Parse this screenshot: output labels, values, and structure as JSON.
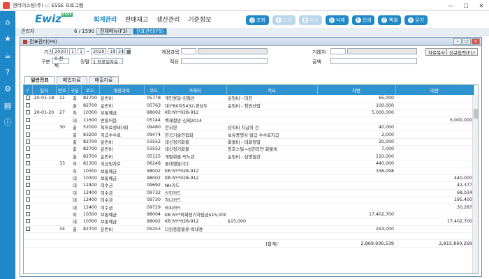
{
  "window": {
    "title": "엔터이스팅(주) ::: ESSE 프로그램",
    "controls": [
      "—",
      "☐",
      "✕"
    ]
  },
  "header": {
    "logo": {
      "text_e": "E",
      "text_wiz": "wiz",
      "badge": "ESSE"
    },
    "menus": [
      "회계관리",
      "판매재고",
      "생산관리",
      "기준정보"
    ],
    "toolbar": [
      {
        "label": "조회",
        "icon": "Q"
      },
      {
        "label": "입력",
        "icon": "I"
      },
      {
        "label": "저장",
        "icon": "S"
      },
      {
        "label": "삭제",
        "icon": "D"
      },
      {
        "label": "인쇄",
        "icon": "P"
      },
      {
        "label": "엑셀",
        "icon": "E"
      },
      {
        "label": "닫기",
        "icon": "X"
      }
    ]
  },
  "status": {
    "user": "관리자",
    "count": "6 / 1590",
    "tabs": [
      "전체메뉴(F3)",
      "전표관리(F9)"
    ]
  },
  "subwindow": {
    "title": "전표관리(F9)"
  },
  "filter": {
    "period_label": "기간",
    "from_y": "2020",
    "from_m": "1",
    "from_d": "1",
    "to_y": "2020",
    "to_m": "10",
    "to_d": "24",
    "account_label": "계정과목",
    "vendor_label": "거래처",
    "type_label": "구분",
    "type_value": "0.전체",
    "sort_label": "정렬",
    "sort_value": "1.전표일자순",
    "memo_label": "적요",
    "amount_label": "금액",
    "copy_btn": "자료복사",
    "new_btn": "신규입력(F1)"
  },
  "tabs": [
    "일반전표",
    "매입자료",
    "매출자료"
  ],
  "columns": [
    "√",
    "일자",
    "번호",
    "구분",
    "코드",
    "계정과목",
    "코드",
    "거래처",
    "적요",
    "차변",
    "대변"
  ],
  "rows": [
    [
      "20-01-18",
      "11",
      "출",
      "82700",
      "운반비",
      "05778",
      "개인용달-김철선",
      "운임비 - 미진",
      "65,000",
      ""
    ],
    [
      "",
      "",
      "출",
      "82700",
      "운반비",
      "05763",
      "대구80자5432-광상두",
      "운임비 - 청원산업",
      "100,000",
      ""
    ],
    [
      "20-01-20",
      "27",
      "차",
      "10300",
      "보통예금",
      "98002",
      "KB NY*028-912",
      "",
      "5,000,000",
      ""
    ],
    [
      "",
      "",
      "대",
      "11600",
      "받을어음",
      "05144",
      "백제철망-김제2014",
      "",
      "",
      "5,000,000"
    ],
    [
      "",
      "30",
      "출",
      "52000",
      "특허료성비(제)",
      "09480",
      "한국판",
      "당직비 지급의 건",
      "40,000",
      ""
    ],
    [
      "",
      "",
      "출",
      "83200",
      "지급수수료",
      "09474",
      "한국기술인협회",
      "보유증명서 발급 수수료지급",
      "2,000",
      ""
    ],
    [
      "",
      "",
      "출",
      "82700",
      "운반비",
      "03552",
      "대신정기화물",
      "화물비 - 태화정밀",
      "20,000",
      ""
    ],
    [
      "",
      "",
      "출",
      "82700",
      "운반비",
      "03552",
      "대신정기화물",
      "청호스틸→성진리얀 화물비",
      "7,000",
      ""
    ],
    [
      "",
      "",
      "출",
      "82700",
      "운반비",
      "05125",
      "개별화물-박노관",
      "운임비 - 심명철강",
      "110,000",
      ""
    ],
    [
      "",
      "33",
      "차",
      "81300",
      "지급임차료",
      "06248",
      "롯데렌탈(주)",
      "",
      "440,000",
      ""
    ],
    [
      "",
      "",
      "차",
      "10300",
      "보통예금",
      "98002",
      "KB NY*028-912",
      "",
      "336,098",
      ""
    ],
    [
      "",
      "",
      "대",
      "10300",
      "보통예금",
      "98002",
      "KB NY*028-912",
      "",
      "",
      "440,000"
    ],
    [
      "",
      "",
      "대",
      "12400",
      "미수금",
      "09692",
      "NH카드",
      "",
      "",
      "42,377"
    ],
    [
      "",
      "",
      "대",
      "12400",
      "미수금",
      "09732",
      "신한카드",
      "",
      "",
      "68,034"
    ],
    [
      "",
      "",
      "대",
      "12400",
      "미수금",
      "09730",
      "하나카드",
      "",
      "",
      "195,400"
    ],
    [
      "",
      "",
      "대",
      "12400",
      "미수금",
      "09729",
      "비씨카드",
      "",
      "",
      "30,287"
    ],
    [
      "",
      "",
      "차",
      "10300",
      "보통예금",
      "98004",
      "KB NY*외화정기자입금$15,000",
      "",
      "17,402,700",
      ""
    ],
    [
      "",
      "",
      "대",
      "10300",
      "보통예금",
      "98002",
      "KB NY*028-912",
      "$15,000",
      "",
      "17,402,700"
    ],
    [
      "",
      "34",
      "출",
      "82700",
      "운반비",
      "05253",
      "다원종합물류-박대용",
      "",
      "253,000",
      ""
    ]
  ],
  "summary": {
    "label": "[합계]",
    "debit": "2,869,936,539",
    "credit": "2,815,860,269"
  }
}
